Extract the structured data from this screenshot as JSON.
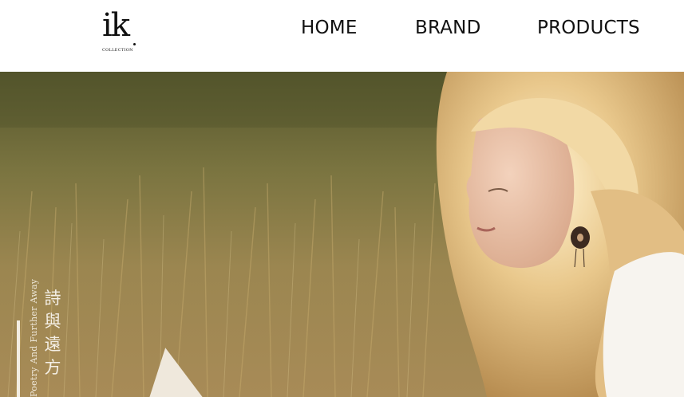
{
  "brand": {
    "logo_main": "ik",
    "logo_sub": "COLLECTION"
  },
  "nav": {
    "items": [
      {
        "label": "HOME"
      },
      {
        "label": "BRAND"
      },
      {
        "label": "PRODUCTS"
      }
    ]
  },
  "hero": {
    "title_cn": [
      "詩",
      "與",
      "遠",
      "方"
    ],
    "subtitle_en": "Poetry And Further Away"
  },
  "colors": {
    "header_bg": "#ffffff",
    "nav_text": "#111111",
    "hero_text": "#f4efe6"
  }
}
